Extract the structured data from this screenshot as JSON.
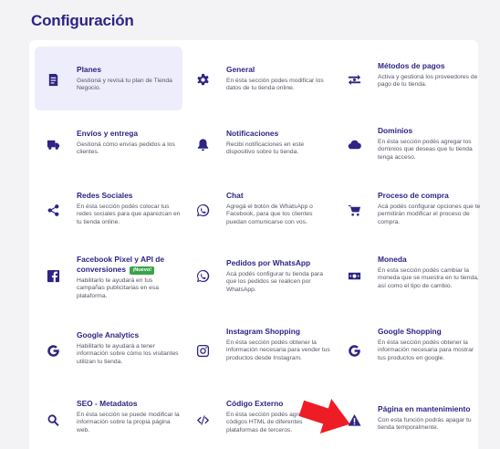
{
  "page_title": "Configuración",
  "colors": {
    "accent": "#2d2485",
    "active_bg": "#eeedfb",
    "badge": "#3aa34a",
    "arrow": "#ee1c24"
  },
  "cards": [
    {
      "title": "Planes",
      "desc": "Gestioná y revisá tu plan de Tienda Negocio.",
      "icon": "plan-document-icon"
    },
    {
      "title": "General",
      "desc": "En ésta sección podes modificar los datos de tu tienda online.",
      "icon": "gear-icon"
    },
    {
      "title": "Métodos de pagos",
      "desc": "Activa y gestioná los proveedores de pago de tu tienda.",
      "icon": "money-exchange-icon"
    },
    {
      "title": "Envíos y entrega",
      "desc": "Gestioná cómo envías pedidos a los clientes.",
      "icon": "truck-icon"
    },
    {
      "title": "Notificaciones",
      "desc": "Recibí notificaciones en este dispositivo sobre tu tienda.",
      "icon": "bell-icon"
    },
    {
      "title": "Dominios",
      "desc": "En ésta sección podés agregar los dominios que deseas que tu tienda tenga acceso.",
      "icon": "cloud-icon"
    },
    {
      "title": "Redes Sociales",
      "desc": "En ésta sección podés colocar tus redes sociales para que aparezcan en tu tienda online.",
      "icon": "share-icon"
    },
    {
      "title": "Chat",
      "desc": "Agregá el botón de WhatsApp o Facebook, para que los clientes puedan comunicarse con vos.",
      "icon": "whatsapp-icon"
    },
    {
      "title": "Proceso de compra",
      "desc": "Acá podés configurar opciones que te permitirán modificar el proceso de compra.",
      "icon": "cart-icon"
    },
    {
      "title": "Facebook Pixel y API de conversiones",
      "badge": "¡Nuevo!",
      "desc": "Habilitarlo te ayudará en tus campañas publicitarias en esa plataforma.",
      "icon": "facebook-icon"
    },
    {
      "title": "Pedidos por WhatsApp",
      "desc": "Acá podés configurar tu tienda para que los pedidos se realicen por WhatsApp.",
      "icon": "whatsapp-icon"
    },
    {
      "title": "Moneda",
      "desc": "En esta sección podés cambiar la moneda que se muestra en tu tienda, así como el tipo de cambio.",
      "icon": "banknote-icon"
    },
    {
      "title": "Google Analytics",
      "desc": "Habilitarlo te ayudará a tener información sobre cómo los visitantes utilizan tu tienda.",
      "icon": "google-icon"
    },
    {
      "title": "Instagram Shopping",
      "desc": "En ésta sección podés obtener la información necesaria para vender tus productos desde Instagram.",
      "icon": "instagram-icon"
    },
    {
      "title": "Google Shopping",
      "desc": "En ésta sección podés obtener la información necesaria para mostrar tus productos en google.",
      "icon": "google-icon"
    },
    {
      "title": "SEO - Metadatos",
      "desc": "En ésta sección se puede modificar la información sobre la propia página web.",
      "icon": "search-icon"
    },
    {
      "title": "Código Externo",
      "desc": "En ésta sección podés agregar los códigos HTML de diferentes plataformas de terceros.",
      "icon": "code-icon"
    },
    {
      "title": "Página en mantenimiento",
      "desc": "Con esta función podrás apagar tu tienda temporalmente.",
      "icon": "warning-icon"
    }
  ]
}
